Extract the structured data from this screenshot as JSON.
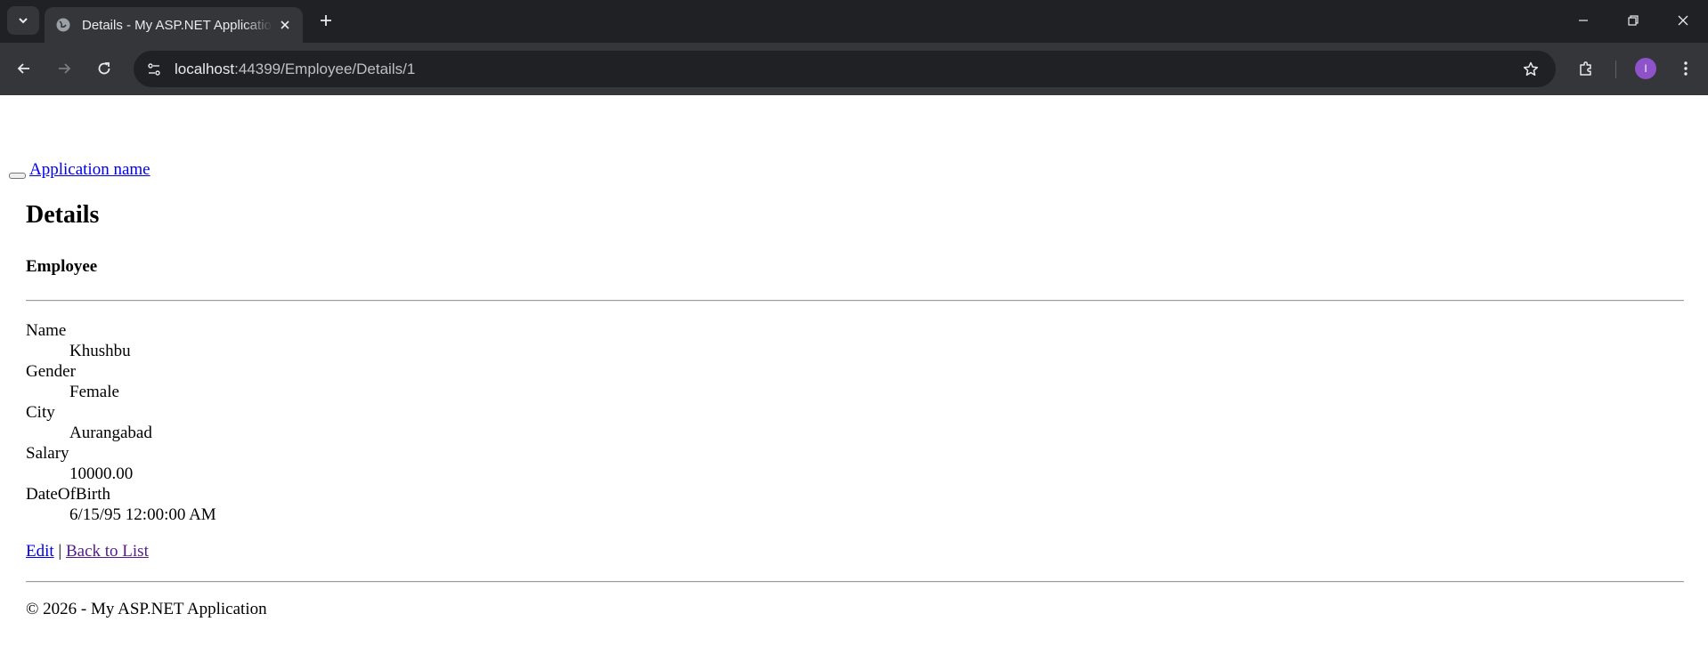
{
  "browser": {
    "tab_title": "Details - My ASP.NET Application",
    "url_host": "localhost",
    "url_path": ":44399/Employee/Details/1",
    "profile_initial": "I"
  },
  "page": {
    "brand": "Application name",
    "heading": "Details",
    "subheading": "Employee",
    "fields": [
      {
        "label": "Name",
        "value": "Khushbu"
      },
      {
        "label": "Gender",
        "value": "Female"
      },
      {
        "label": "City",
        "value": "Aurangabad"
      },
      {
        "label": "Salary",
        "value": "10000.00"
      },
      {
        "label": "DateOfBirth",
        "value": "6/15/95 12:00:00 AM"
      }
    ],
    "edit_link": "Edit",
    "separator": " | ",
    "back_link": "Back to List",
    "footer": "© 2026 - My ASP.NET Application"
  }
}
